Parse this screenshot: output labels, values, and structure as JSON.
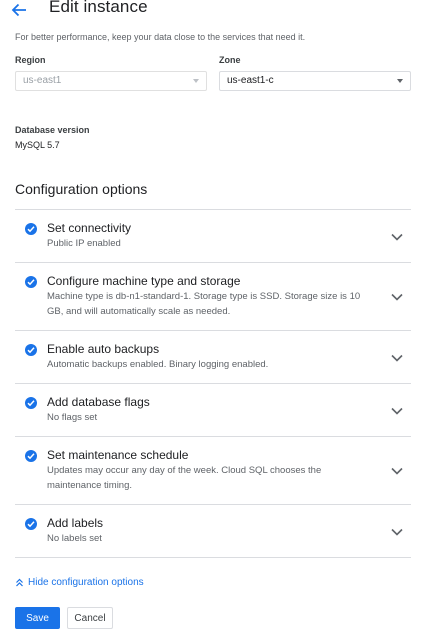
{
  "header": {
    "title": "Edit instance",
    "back_icon": "arrow-left-icon"
  },
  "hint": "For better performance, keep your data close to the services that need it.",
  "region": {
    "label": "Region",
    "value": "us-east1",
    "disabled": true
  },
  "zone": {
    "label": "Zone",
    "value": "us-east1-c",
    "disabled": false
  },
  "database_version": {
    "label": "Database version",
    "value": "MySQL 5.7"
  },
  "config": {
    "title": "Configuration options",
    "items": [
      {
        "title": "Set connectivity",
        "description": "Public IP enabled"
      },
      {
        "title": "Configure machine type and storage",
        "description": "Machine type is db-n1-standard-1. Storage type is SSD. Storage size is 10 GB, and will automatically scale as needed."
      },
      {
        "title": "Enable auto backups",
        "description": "Automatic backups enabled. Binary logging enabled."
      },
      {
        "title": "Add database flags",
        "description": "No flags set"
      },
      {
        "title": "Set maintenance schedule",
        "description": "Updates may occur any day of the week. Cloud SQL chooses the maintenance timing."
      },
      {
        "title": "Add labels",
        "description": "No labels set"
      }
    ]
  },
  "hide_link": "Hide configuration options",
  "buttons": {
    "save": "Save",
    "cancel": "Cancel"
  },
  "colors": {
    "accent": "#1a73e8",
    "text": "#202124",
    "muted": "#5f6368",
    "divider": "#dadce0"
  }
}
